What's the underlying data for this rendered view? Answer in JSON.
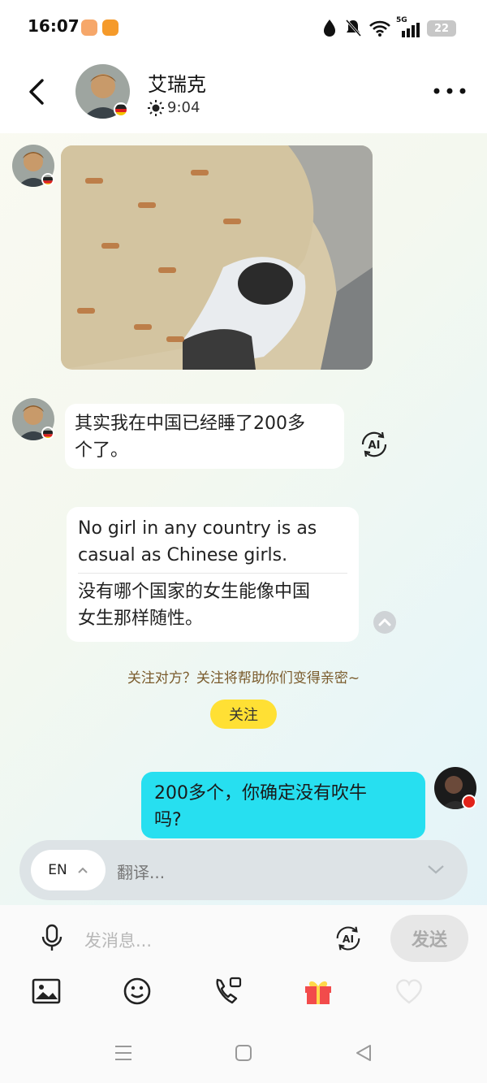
{
  "status_bar": {
    "time": "16:07",
    "network": "5G",
    "battery": "22",
    "icons": [
      "app-badge-icon",
      "app-badge-icon",
      "water-drop-icon",
      "bell-muted-icon",
      "wifi-icon",
      "signal-icon",
      "battery-icon"
    ]
  },
  "header": {
    "contact_name": "艾瑞克",
    "status_time": "9:04",
    "status_icon": "sun-icon",
    "flag": "germany-flag"
  },
  "messages": {
    "text_1_line_1": "其实我在中国已经睡了200多",
    "text_1_line_2": "个了。",
    "original_line_1": "No girl in any country is as",
    "original_line_2": "casual as Chinese girls.",
    "translation_line_1": "没有哪个国家的女生能像中国",
    "translation_line_2": "女生那样随性。",
    "my_line_1": "200多个，你确定没有吹牛",
    "my_line_2": "吗?"
  },
  "ai_badge_label": "AI",
  "follow": {
    "hint": "关注对方？关注将帮助你们变得亲密~",
    "button": "关注"
  },
  "translate_bar": {
    "language": "EN",
    "placeholder": "翻译..."
  },
  "input": {
    "placeholder": "发消息...",
    "send": "发送"
  },
  "colors": {
    "my_bubble": "#27dff0",
    "follow_button": "#ffe034",
    "gift": "#f24b4b"
  }
}
